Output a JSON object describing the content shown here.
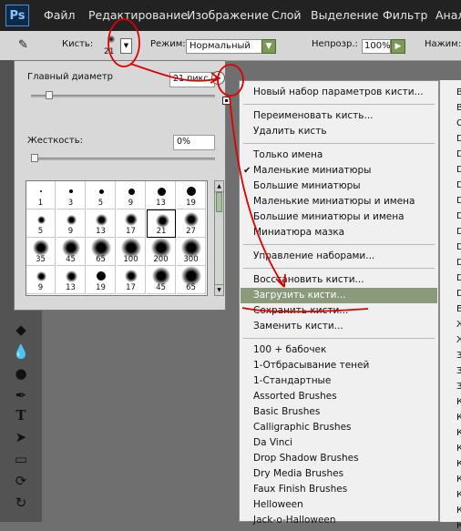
{
  "menubar": {
    "logo": "Ps",
    "items": [
      "Файл",
      "Редактирование",
      "Изображение",
      "Слой",
      "Выделение",
      "Фильтр",
      "Анал"
    ]
  },
  "options": {
    "brush_label": "Кисть:",
    "brush_size": "21",
    "mode_label": "Режим:",
    "mode_value": "Нормальный",
    "opacity_label": "Непрозр.:",
    "opacity_value": "100%",
    "pressure_label": "Нажим:"
  },
  "brush_panel": {
    "diameter_label": "Главный диаметр",
    "diameter_value": "21 пикс",
    "hardness_label": "Жесткость:",
    "hardness_value": "0%",
    "diameter_level": 0.1,
    "hardness_level": 0.0,
    "presets": [
      {
        "size": "1",
        "soft": false,
        "selected": false
      },
      {
        "size": "3",
        "soft": false,
        "selected": false
      },
      {
        "size": "5",
        "soft": false,
        "selected": false
      },
      {
        "size": "9",
        "soft": false,
        "selected": false
      },
      {
        "size": "13",
        "soft": false,
        "selected": false
      },
      {
        "size": "19",
        "soft": false,
        "selected": false
      },
      {
        "size": "5",
        "soft": true,
        "selected": false
      },
      {
        "size": "9",
        "soft": true,
        "selected": false
      },
      {
        "size": "13",
        "soft": true,
        "selected": false
      },
      {
        "size": "17",
        "soft": true,
        "selected": false
      },
      {
        "size": "21",
        "soft": true,
        "selected": true
      },
      {
        "size": "27",
        "soft": true,
        "selected": false
      },
      {
        "size": "35",
        "soft": true,
        "selected": false
      },
      {
        "size": "45",
        "soft": true,
        "selected": false
      },
      {
        "size": "65",
        "soft": true,
        "selected": false
      },
      {
        "size": "100",
        "soft": true,
        "selected": false
      },
      {
        "size": "200",
        "soft": true,
        "selected": false
      },
      {
        "size": "300",
        "soft": true,
        "selected": false
      },
      {
        "size": "9",
        "soft": true,
        "selected": false
      },
      {
        "size": "13",
        "soft": true,
        "selected": false
      },
      {
        "size": "19",
        "soft": false,
        "selected": false
      },
      {
        "size": "17",
        "soft": true,
        "selected": false
      },
      {
        "size": "45",
        "soft": true,
        "selected": false
      },
      {
        "size": "65",
        "soft": true,
        "selected": false
      }
    ]
  },
  "menu": {
    "items": [
      {
        "label": "Новый набор параметров кисти...",
        "check": false,
        "highlight": false,
        "sep_before": false
      },
      {
        "label": "Переименовать кисть...",
        "check": false,
        "highlight": false,
        "sep_before": true
      },
      {
        "label": "Удалить кисть",
        "check": false,
        "highlight": false,
        "sep_before": false
      },
      {
        "label": "Только имена",
        "check": false,
        "highlight": false,
        "sep_before": true
      },
      {
        "label": "Маленькие миниатюры",
        "check": true,
        "highlight": false,
        "sep_before": false
      },
      {
        "label": "Большие миниатюры",
        "check": false,
        "highlight": false,
        "sep_before": false
      },
      {
        "label": "Маленькие миниатюры и имена",
        "check": false,
        "highlight": false,
        "sep_before": false
      },
      {
        "label": "Большие миниатюры и имена",
        "check": false,
        "highlight": false,
        "sep_before": false
      },
      {
        "label": "Миниатюра мазка",
        "check": false,
        "highlight": false,
        "sep_before": false
      },
      {
        "label": "Управление наборами...",
        "check": false,
        "highlight": false,
        "sep_before": true
      },
      {
        "label": "Восстановить кисти...",
        "check": false,
        "highlight": false,
        "sep_before": true
      },
      {
        "label": "Загрузить кисти...",
        "check": false,
        "highlight": true,
        "sep_before": false
      },
      {
        "label": "Сохранить кисти...",
        "check": false,
        "highlight": false,
        "sep_before": false
      },
      {
        "label": "Заменить кисти...",
        "check": false,
        "highlight": false,
        "sep_before": false
      },
      {
        "label": "100 + бабочек",
        "check": false,
        "highlight": false,
        "sep_before": true
      },
      {
        "label": "1-Отбрасывание теней",
        "check": false,
        "highlight": false,
        "sep_before": false
      },
      {
        "label": "1-Стандартные",
        "check": false,
        "highlight": false,
        "sep_before": false
      },
      {
        "label": "Assorted Brushes",
        "check": false,
        "highlight": false,
        "sep_before": false
      },
      {
        "label": "Basic Brushes",
        "check": false,
        "highlight": false,
        "sep_before": false
      },
      {
        "label": "Calligraphic Brushes",
        "check": false,
        "highlight": false,
        "sep_before": false
      },
      {
        "label": "Da Vinci",
        "check": false,
        "highlight": false,
        "sep_before": false
      },
      {
        "label": "Drop Shadow Brushes",
        "check": false,
        "highlight": false,
        "sep_before": false
      },
      {
        "label": "Dry Media Brushes",
        "check": false,
        "highlight": false,
        "sep_before": false
      },
      {
        "label": "Faux Finish Brushes",
        "check": false,
        "highlight": false,
        "sep_before": false
      },
      {
        "label": "Helloween",
        "check": false,
        "highlight": false,
        "sep_before": false
      },
      {
        "label": "Jack-o-Halloween",
        "check": false,
        "highlight": false,
        "sep_before": false
      }
    ]
  },
  "right_list": [
    "B",
    "B",
    "C",
    "D",
    "D",
    "D",
    "D",
    "D",
    "D",
    "D",
    "D",
    "D",
    "D",
    "D",
    "E",
    "Ж",
    "Ж",
    "З",
    "З",
    "З",
    "К",
    "К",
    "К",
    "К",
    "К",
    "К",
    "К",
    "К",
    "К"
  ],
  "colors": {
    "highlight": "#8a9a7a",
    "annotation": "#e00000"
  }
}
